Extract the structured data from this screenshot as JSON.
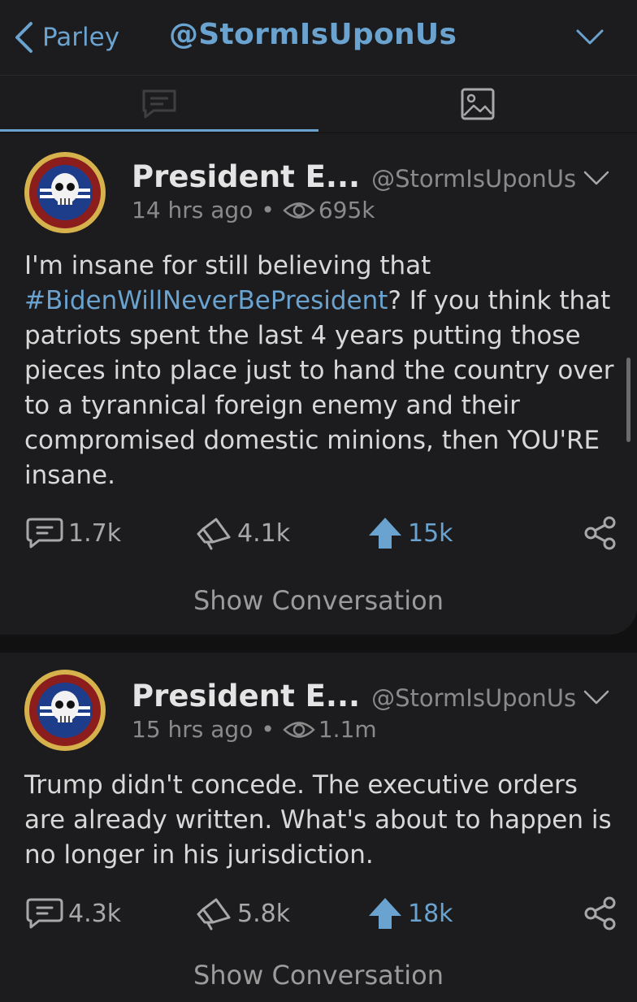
{
  "topbar": {
    "back_label": "Parley",
    "title": "@StormIsUponUs"
  },
  "tabs": [
    {
      "icon": "posts-icon",
      "active": true
    },
    {
      "icon": "media-icon",
      "active": false
    }
  ],
  "posts": [
    {
      "display_name": "President E...",
      "handle": "@StormIsUponUs",
      "time": "14 hrs ago",
      "separator": "•",
      "views": "695k",
      "text_before": "I'm insane for still believing that ",
      "hashtag": "#BidenWillNeverBePresident",
      "text_after": "? If you think that patriots spent the last 4 years putting those pieces into place just to hand the country over to a tyrannical foreign enemy and their compromised domestic minions, then YOU'RE insane.",
      "comments": "1.7k",
      "echoes": "4.1k",
      "upvotes": "15k",
      "show_conversation": "Show Conversation"
    },
    {
      "display_name": "President E...",
      "handle": "@StormIsUponUs",
      "time": "15 hrs ago",
      "separator": "•",
      "views": "1.1m",
      "text_before": "Trump didn't concede. The executive orders are already written. What's about to happen is no longer in his jurisdiction.",
      "hashtag": "",
      "text_after": "",
      "comments": "4.3k",
      "echoes": "5.8k",
      "upvotes": "18k",
      "show_conversation": "Show Conversation"
    }
  ],
  "colors": {
    "accent": "#6aa3cf",
    "background": "#111111",
    "card": "#1c1c1e",
    "muted": "#8a8a8a"
  }
}
